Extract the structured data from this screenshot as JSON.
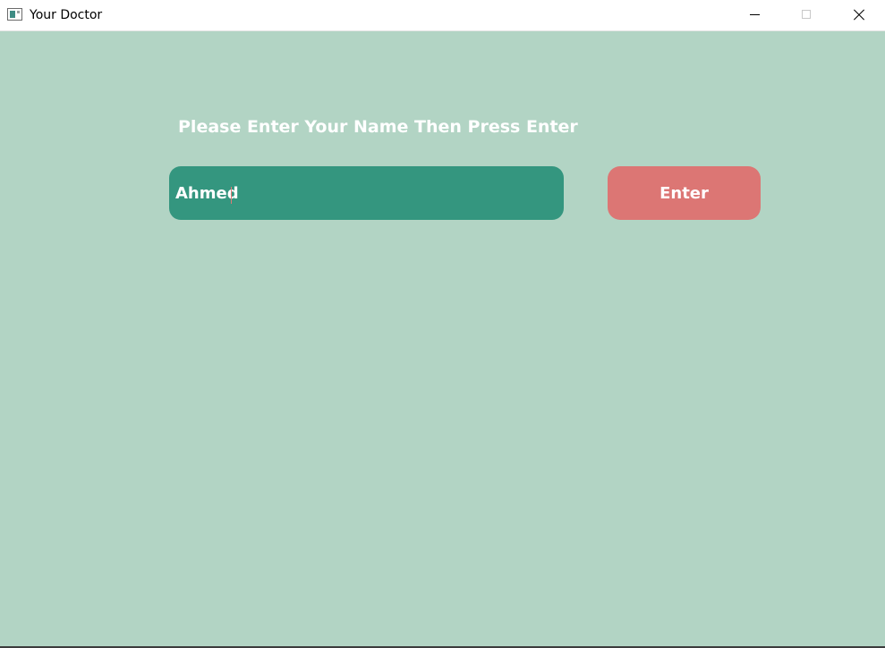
{
  "window": {
    "title": "Your Doctor",
    "icon": "app-window-icon",
    "controls": {
      "minimize_icon": "minimize-icon",
      "maximize_icon": "maximize-icon",
      "close_icon": "close-icon"
    }
  },
  "main": {
    "prompt": "Please Enter Your Name Then Press Enter",
    "name_input": {
      "value": "Ahmed",
      "placeholder": ""
    },
    "enter_button_label": "Enter"
  },
  "colors": {
    "background": "#b2d4c4",
    "input_fill": "#34967f",
    "button_fill": "#dc7674",
    "text": "#ffffff"
  }
}
